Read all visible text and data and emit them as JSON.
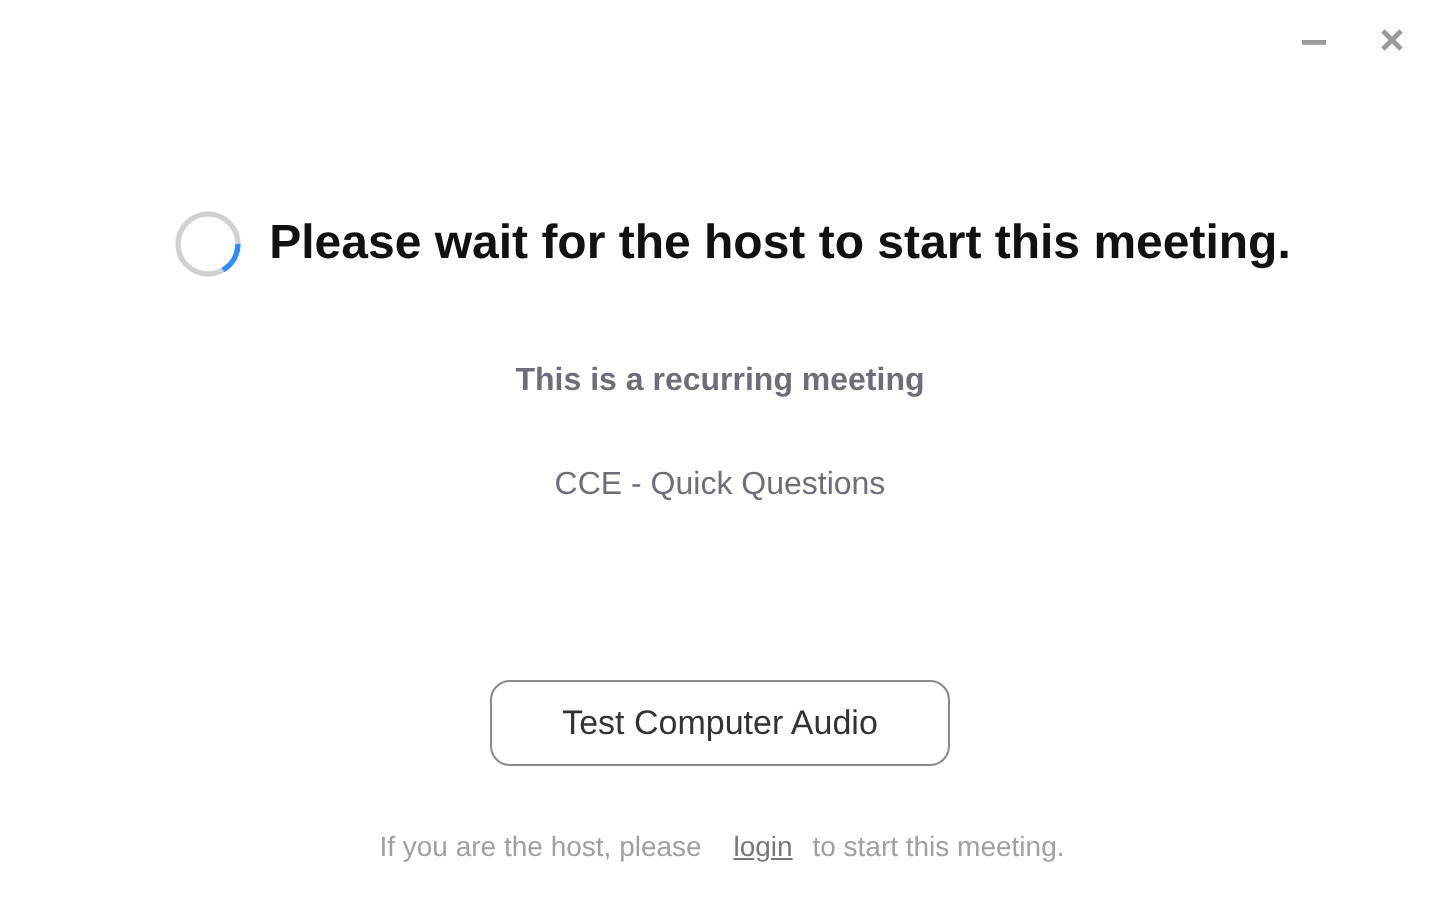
{
  "window": {
    "controls": [
      {
        "kind": "minimize"
      },
      {
        "kind": "close"
      }
    ]
  },
  "status": {
    "message": "Please wait for the host to start this meeting.",
    "loading": true
  },
  "meeting": {
    "type_label": "This is a recurring meeting",
    "name": "CCE - Quick Questions"
  },
  "buttons": [
    {
      "label": "Test Computer Audio"
    }
  ],
  "footer": {
    "before": "If you are the host, please",
    "link": "login",
    "after": "to start this meeting."
  }
}
